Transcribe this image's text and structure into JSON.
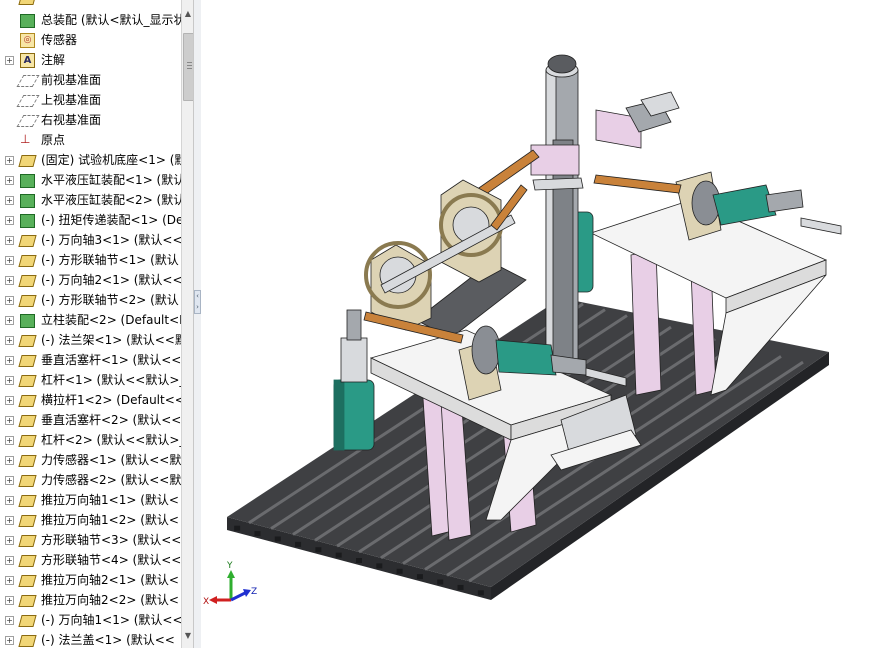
{
  "tree": {
    "rows": [
      {
        "label": "",
        "icon": "arrow-icon",
        "expand": false
      },
      {
        "label": "总装配 (默认<默认_显示状态",
        "icon": "assembly-icon",
        "expand": false
      },
      {
        "label": "传感器",
        "icon": "sensor-icon",
        "expand": false
      },
      {
        "label": "注解",
        "icon": "annotation-icon",
        "expand": true
      },
      {
        "label": "前视基准面",
        "icon": "plane-icon",
        "expand": false
      },
      {
        "label": "上视基准面",
        "icon": "plane-icon",
        "expand": false
      },
      {
        "label": "右视基准面",
        "icon": "plane-icon",
        "expand": false
      },
      {
        "label": "原点",
        "icon": "origin-icon",
        "expand": false
      },
      {
        "label": "(固定) 试验机底座<1> (默",
        "icon": "part-icon",
        "expand": true
      },
      {
        "label": "水平液压缸装配<1> (默认",
        "icon": "assembly-icon",
        "expand": true
      },
      {
        "label": "水平液压缸装配<2> (默认",
        "icon": "assembly-icon",
        "expand": true
      },
      {
        "label": "(-) 扭矩传递装配<1> (De",
        "icon": "assembly-icon",
        "expand": true
      },
      {
        "label": "(-) 万向轴3<1> (默认<<",
        "icon": "part-icon",
        "expand": true
      },
      {
        "label": "(-) 方形联轴节<1> (默认",
        "icon": "part-icon",
        "expand": true
      },
      {
        "label": "(-) 万向轴2<1> (默认<<",
        "icon": "part-icon",
        "expand": true
      },
      {
        "label": "(-) 方形联轴节<2> (默认",
        "icon": "part-icon",
        "expand": true
      },
      {
        "label": "立柱装配<2> (Default<D",
        "icon": "assembly-icon",
        "expand": true
      },
      {
        "label": "(-) 法兰架<1> (默认<<默",
        "icon": "part-icon",
        "expand": true
      },
      {
        "label": "垂直活塞杆<1> (默认<<",
        "icon": "part-icon",
        "expand": true
      },
      {
        "label": "杠杆<1> (默认<<默认>_",
        "icon": "part-icon",
        "expand": true
      },
      {
        "label": "横拉杆1<2> (Default<<",
        "icon": "part-icon",
        "expand": true
      },
      {
        "label": "垂直活塞杆<2> (默认<<",
        "icon": "part-icon",
        "expand": true
      },
      {
        "label": "杠杆<2> (默认<<默认>_",
        "icon": "part-icon",
        "expand": true
      },
      {
        "label": "力传感器<1> (默认<<默",
        "icon": "part-icon",
        "expand": true
      },
      {
        "label": "力传感器<2> (默认<<默",
        "icon": "part-icon",
        "expand": true
      },
      {
        "label": "推拉万向轴1<1> (默认<",
        "icon": "part-icon",
        "expand": true
      },
      {
        "label": "推拉万向轴1<2> (默认<",
        "icon": "part-icon",
        "expand": true
      },
      {
        "label": "方形联轴节<3> (默认<<",
        "icon": "part-icon",
        "expand": true
      },
      {
        "label": "方形联轴节<4> (默认<<",
        "icon": "part-icon",
        "expand": true
      },
      {
        "label": "推拉万向轴2<1> (默认<",
        "icon": "part-icon",
        "expand": true
      },
      {
        "label": "推拉万向轴2<2> (默认<",
        "icon": "part-icon",
        "expand": true
      },
      {
        "label": "(-) 万向轴1<1> (默认<<",
        "icon": "part-icon",
        "expand": true
      },
      {
        "label": "(-) 法兰盖<1> (默认<<",
        "icon": "part-icon",
        "expand": true
      }
    ]
  },
  "triad": {
    "x_label": "X",
    "y_label": "Y",
    "z_label": "Z"
  },
  "colors": {
    "rail": "#3f4043",
    "rail_top": "#6a6b6e",
    "plate": "#f4f4f4",
    "frame_pink": "#e8cfe6",
    "cylinder_teal": "#2a9a86",
    "shaft_orange": "#c9823a",
    "bracket_tan": "#ddd3b4",
    "column_grey": "#a4a8ad"
  }
}
